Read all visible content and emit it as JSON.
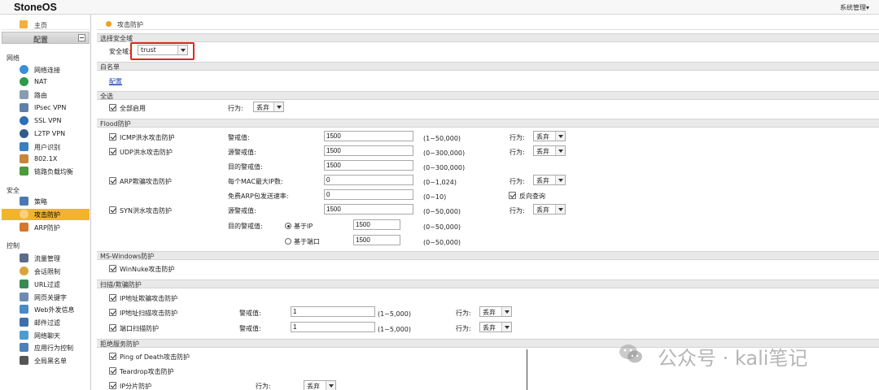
{
  "app": {
    "brand": "StoneOS",
    "system_menu": "系统管理▾"
  },
  "sidebar": {
    "home": "主页",
    "config": "配置",
    "groups": {
      "network": "网络",
      "security": "安全",
      "control": "控制"
    },
    "network_items": [
      "网络连接",
      "NAT",
      "路由",
      "IPsec VPN",
      "SSL VPN",
      "L2TP VPN",
      "用户识别",
      "802.1X",
      "链路负载均衡"
    ],
    "security_items": [
      "策略",
      "攻击防护",
      "ARP防护"
    ],
    "control_items": [
      "流量管理",
      "会话限制",
      "URL过滤",
      "网页关键字",
      "Web外发信息",
      "邮件过滤",
      "网络聊天",
      "应用行为控制",
      "全局黑名单"
    ]
  },
  "breadcrumb": "攻击防护",
  "zone": {
    "section": "选择安全域",
    "label": "安全域:",
    "value": "trust"
  },
  "whitelist": {
    "section": "白名单",
    "link": "配置"
  },
  "all": {
    "section": "全选",
    "enable_label": "全部启用",
    "action_label": "行为:",
    "action_value": "丢弃"
  },
  "flood": {
    "section": "Flood防护",
    "icmp": {
      "label": "ICMP洪水攻击防护",
      "threshold_label": "警戒值:",
      "threshold": "1500",
      "range": "(1~50,000)",
      "action_label": "行为:",
      "action": "丢弃"
    },
    "udp": {
      "label": "UDP洪水攻击防护",
      "src_label": "源警戒值:",
      "src": "1500",
      "src_range": "(0~300,000)",
      "dst_label": "目的警戒值:",
      "dst": "1500",
      "dst_range": "(0~300,000)",
      "action_label": "行为:",
      "action": "丢弃"
    },
    "arp": {
      "label": "ARP欺骗攻击防护",
      "mac_label": "每个MAC最大IP数:",
      "mac": "0",
      "mac_range": "(0~1,024)",
      "rate_label": "免费ARP包发送速率:",
      "rate": "0",
      "rate_range": "(0~10)",
      "action_label": "行为:",
      "action": "丢弃",
      "reverse_label": "反向查询"
    },
    "syn": {
      "label": "SYN洪水攻击防护",
      "src_label": "源警戒值:",
      "src": "1500",
      "src_range": "(0~50,000)",
      "dst_label": "目的警戒值:",
      "by_ip_label": "基于IP",
      "by_ip": "1500",
      "by_ip_range": "(0~50,000)",
      "by_port_label": "基于端口",
      "by_port": "1500",
      "by_port_range": "(0~50,000)",
      "action_label": "行为:",
      "action": "丢弃"
    }
  },
  "mswin": {
    "section": "MS-Windows防护",
    "winnuke": "WinNuke攻击防护"
  },
  "scan": {
    "section": "扫描/欺骗防护",
    "ip_spoof": "IP地址欺骗攻击防护",
    "ip_scan": {
      "label": "IP地址扫描攻击防护",
      "threshold_label": "警戒值:",
      "threshold": "1",
      "range": "(1~5,000)",
      "action_label": "行为:",
      "action": "丢弃"
    },
    "port_scan": {
      "label": "端口扫描防护",
      "threshold_label": "警戒值:",
      "threshold": "1",
      "range": "(1~5,000)",
      "action_label": "行为:",
      "action": "丢弃"
    }
  },
  "dos": {
    "section": "拒绝服务防护",
    "ping_of_death": "Ping of Death攻击防护",
    "teardrop": "Teardrop攻击防护",
    "ip_frag": {
      "label": "IP分片防护",
      "action_label": "行为:",
      "action": "丢弃"
    }
  },
  "watermark": "公众号 · kali笔记",
  "colors": {
    "active_item": "#f2b42c",
    "highlight_box": "#e0281e",
    "link": "#1a3fb8"
  }
}
